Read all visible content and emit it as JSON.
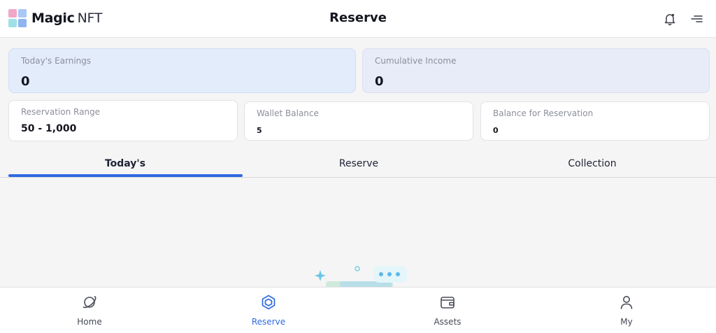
{
  "header": {
    "brand_bold": "Magic",
    "brand_light": "NFT",
    "title": "Reserve",
    "icons": [
      "bell-icon",
      "menu-icon"
    ]
  },
  "summary": {
    "today_earnings": {
      "label": "Today's Earnings",
      "value": "0"
    },
    "cumulative_income": {
      "label": "Cumulative Income",
      "value": "0"
    }
  },
  "info": {
    "reservation_range": {
      "label": "Reservation Range",
      "value": "50 - 1,000"
    },
    "wallet_balance": {
      "label": "Wallet Balance",
      "value": "5"
    },
    "balance_for_reservation": {
      "label": "Balance for Reservation",
      "value": "0"
    }
  },
  "tabs": [
    {
      "label": "Today's",
      "active": true
    },
    {
      "label": "Reserve",
      "active": false
    },
    {
      "label": "Collection",
      "active": false
    }
  ],
  "bottom_nav": [
    {
      "label": "Home",
      "icon": "planet-icon",
      "active": false
    },
    {
      "label": "Reserve",
      "icon": "cube-icon",
      "active": true
    },
    {
      "label": "Assets",
      "icon": "wallet-icon",
      "active": false
    },
    {
      "label": "My",
      "icon": "person-icon",
      "active": false
    }
  ],
  "colors": {
    "accent": "#2f6ae1",
    "card_earnings_bg": "#e3ecfb",
    "card_income_bg": "#e8ebf8",
    "page_bg": "#f5f5f5"
  }
}
